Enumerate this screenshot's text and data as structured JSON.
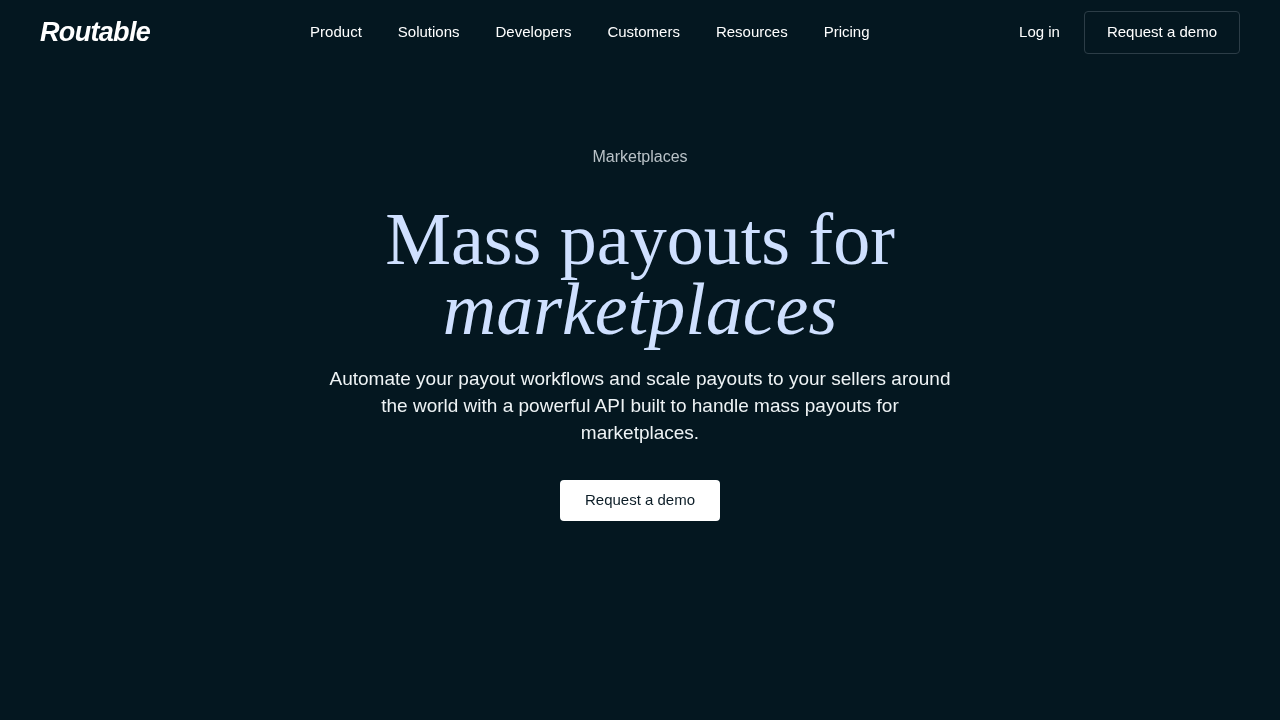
{
  "header": {
    "logo": "Routable",
    "nav": [
      "Product",
      "Solutions",
      "Developers",
      "Customers",
      "Resources",
      "Pricing"
    ],
    "login": "Log in",
    "cta": "Request a demo"
  },
  "hero": {
    "eyebrow": "Marketplaces",
    "title": "Mass payouts for *marketplaces*",
    "description": "Automate your payout workflows and scale payouts to your sellers around the world with a powerful API built to handle mass payouts for marketplaces.",
    "cta": "Request a demo"
  }
}
